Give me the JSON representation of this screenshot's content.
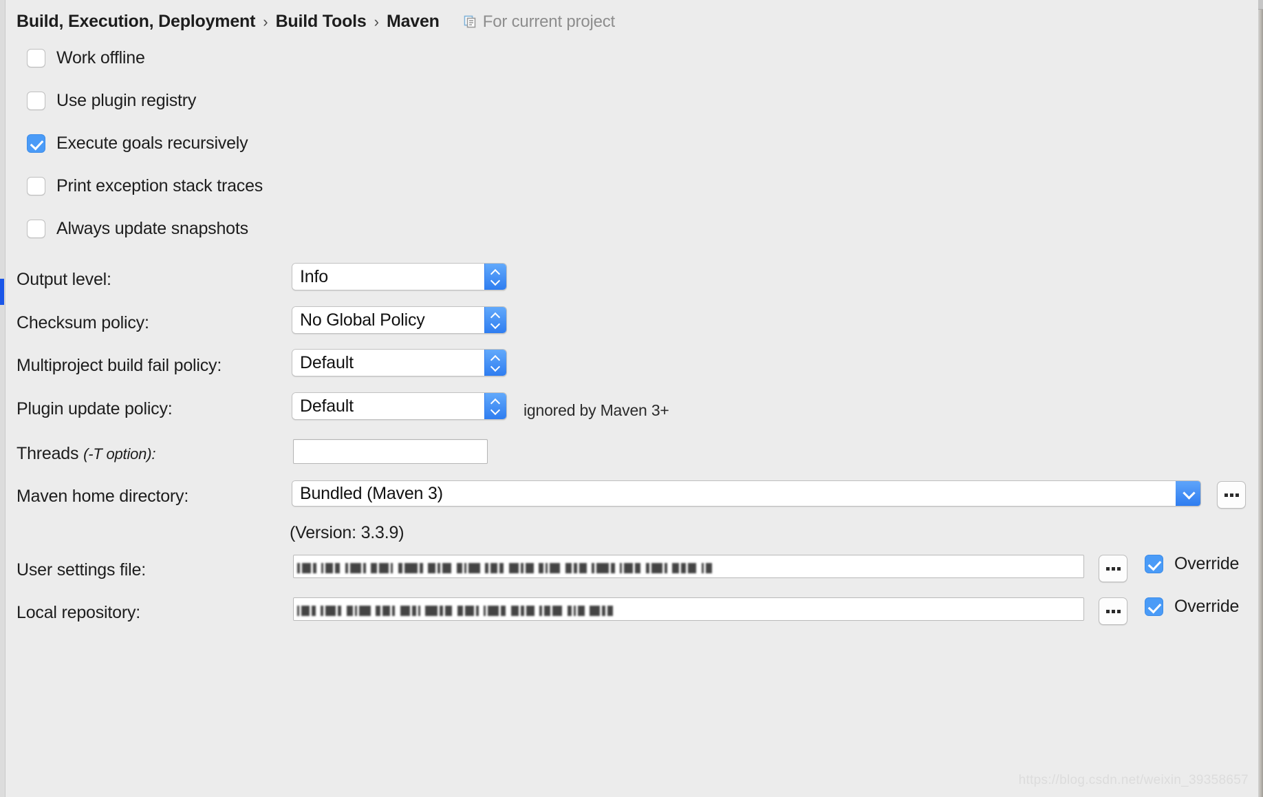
{
  "header": {
    "breadcrumb": [
      "Build, Execution, Deployment",
      "Build Tools",
      "Maven"
    ],
    "separator": "›",
    "scope_icon": "project-scope-icon",
    "scope_label": "For current project"
  },
  "checkboxes": [
    {
      "label": "Work offline",
      "checked": false
    },
    {
      "label": "Use plugin registry",
      "checked": false
    },
    {
      "label": "Execute goals recursively",
      "checked": true
    },
    {
      "label": "Print exception stack traces",
      "checked": false
    },
    {
      "label": "Always update snapshots",
      "checked": false
    }
  ],
  "selects": [
    {
      "label": "Output level:",
      "value": "Info",
      "note": ""
    },
    {
      "label": "Checksum policy:",
      "value": "No Global Policy",
      "note": ""
    },
    {
      "label": "Multiproject build fail policy:",
      "value": "Default",
      "note": ""
    },
    {
      "label": "Plugin update policy:",
      "value": "Default",
      "note": "ignored by Maven 3+"
    }
  ],
  "threads": {
    "label": "Threads",
    "hint": "(-T option):",
    "value": "",
    "placeholder": ""
  },
  "maven_home": {
    "label": "Maven home directory:",
    "value": "Bundled (Maven 3)",
    "version_note": "(Version: 3.3.9)",
    "browse_label": "..."
  },
  "user_settings": {
    "label": "User settings file:",
    "value": "",
    "redacted": true,
    "browse_label": "...",
    "override_label": "Override",
    "override_checked": true
  },
  "local_repository": {
    "label": "Local repository:",
    "value": "",
    "redacted": true,
    "browse_label": "...",
    "override_label": "Override",
    "override_checked": true
  },
  "watermark": "https://blog.csdn.net/weixin_39358657",
  "colors": {
    "background": "#ececec",
    "accent_blue": "#4a9bf7",
    "stepper_blue": "#2f7df0",
    "rail_accent": "#1a56e8",
    "text": "#1d1d1d",
    "muted_text": "#8d8d8d"
  }
}
